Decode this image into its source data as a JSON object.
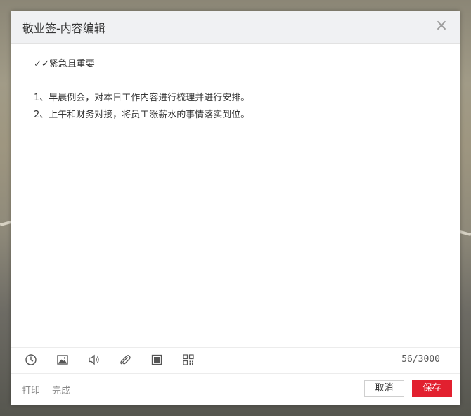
{
  "dialog": {
    "title": "敬业签-内容编辑",
    "close_label": "×"
  },
  "content": {
    "header": "✓✓紧急且重要",
    "items": [
      "1、早晨例会，对本日工作内容进行梳理并进行安排。",
      "2、上午和财务对接，将员工涨薪水的事情落实到位。"
    ]
  },
  "toolbar": {
    "icons": [
      "clock-icon",
      "image-icon",
      "speaker-icon",
      "paperclip-icon",
      "checkbox-icon",
      "qrcode-icon"
    ],
    "counter": "56/3000"
  },
  "footer": {
    "print_label": "打印",
    "done_label": "完成",
    "cancel_label": "取消",
    "save_label": "保存"
  },
  "colors": {
    "accent": "#e2202f",
    "title_bg": "#f0f1f3"
  }
}
